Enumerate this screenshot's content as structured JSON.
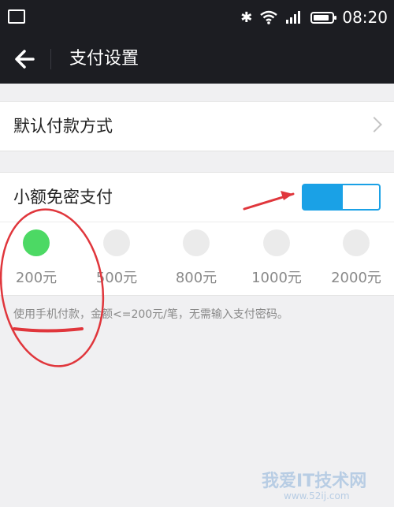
{
  "status": {
    "time": "08:20"
  },
  "header": {
    "title": "支付设置"
  },
  "default_payment": {
    "label": "默认付款方式"
  },
  "small_payment": {
    "label": "小额免密支付",
    "enabled": true,
    "levels": [
      "200元",
      "500元",
      "800元",
      "1000元",
      "2000元"
    ],
    "selected_level": "200元",
    "note": "使用手机付款，金额<=200元/笔，无需输入支付密码。"
  },
  "watermark": {
    "main": "我爱IT技术网",
    "url": "www.52ij.com"
  },
  "colors": {
    "accent": "#1aa1e6",
    "selected": "#4cd964",
    "annotation": "#e0363c",
    "header_bg": "#1c1d22"
  }
}
